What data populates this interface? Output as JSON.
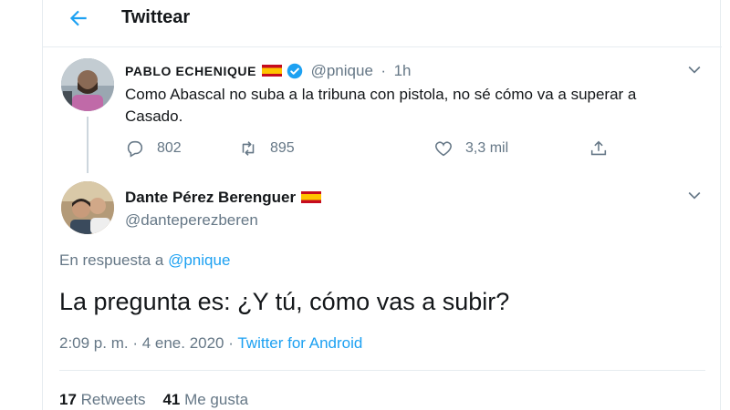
{
  "header": {
    "title": "Twittear"
  },
  "parent_tweet": {
    "author_name": "PABLO ECHENIQUE",
    "handle": "@pnique",
    "time": "1h",
    "separator": "·",
    "text": "Como Abascal no suba a la tribuna con pistola, no sé cómo va a superar a Casado.",
    "counts": {
      "replies": "802",
      "retweets": "895",
      "likes": "3,3 mil"
    },
    "icons": [
      "reply-icon",
      "retweet-icon",
      "like-icon",
      "share-icon",
      "verified-icon",
      "spain-flag-icon"
    ]
  },
  "tweet": {
    "author_name": "Dante Pérez Berenguer",
    "handle": "@danteperezberen",
    "reply_prefix": "En respuesta a",
    "reply_to": "@pnique",
    "text": "La pregunta es: ¿Y tú, cómo vas a subir?",
    "timestamp": "2:09 p. m. · 4 ene. 2020",
    "meta_separator": "·",
    "source": "Twitter for Android",
    "stats": {
      "retweets_count": "17",
      "retweets_label": "Retweets",
      "likes_count": "41",
      "likes_label": "Me gusta"
    }
  },
  "colors": {
    "accent": "#1da1f2",
    "muted": "#657786",
    "text": "#14171a",
    "border": "#e6ecf0",
    "flag_red": "#c60b1e",
    "flag_yellow": "#ffc400"
  }
}
